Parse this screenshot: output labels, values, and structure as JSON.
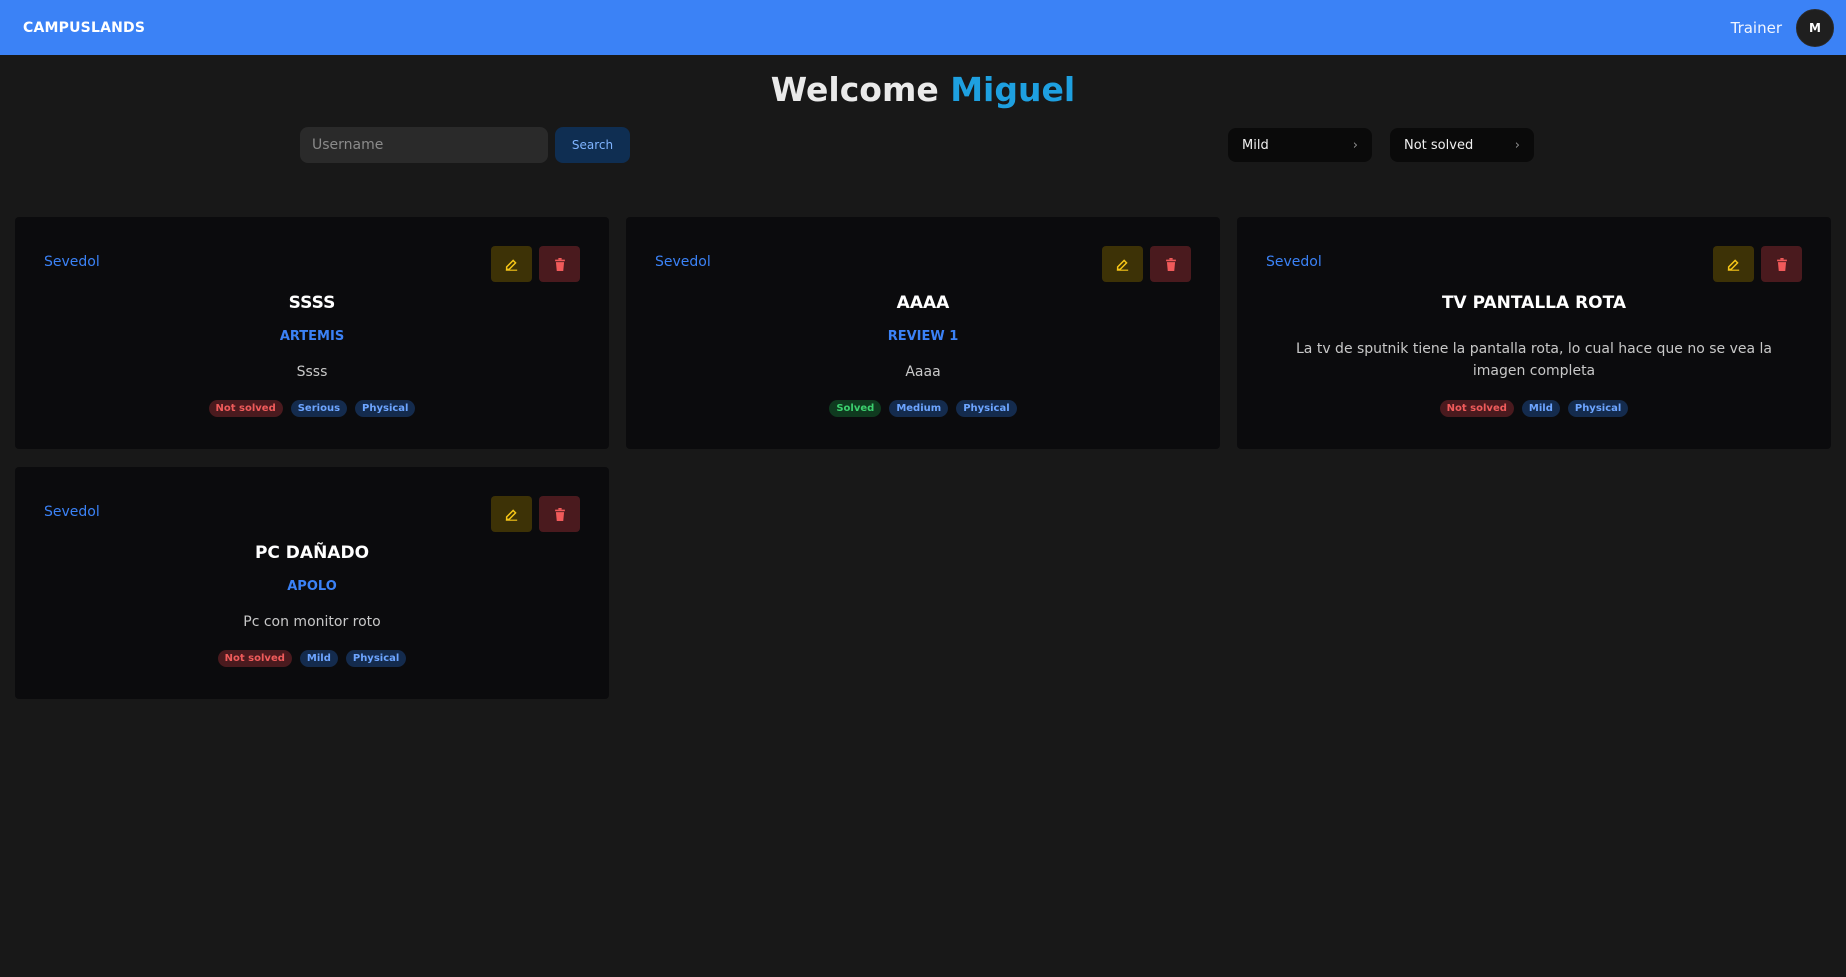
{
  "header": {
    "brand": "CAMPUSLANDS",
    "role": "Trainer",
    "avatar_initial": "M"
  },
  "welcome": {
    "prefix": "Welcome",
    "name": "Miguel"
  },
  "search": {
    "placeholder": "Username",
    "value": "",
    "button_label": "Search"
  },
  "filters": {
    "severity": "Mild",
    "status": "Not solved"
  },
  "colors": {
    "navbar": "#3b82f6",
    "accent": "#3b82f6",
    "welcome_name": "#1ea0e0"
  },
  "cards": [
    {
      "owner": "Sevedol",
      "title": "SSSS",
      "subtitle": "ARTEMIS",
      "description": "Ssss",
      "tags": {
        "status": "Not solved",
        "severity": "Serious",
        "type": "Physical"
      }
    },
    {
      "owner": "Sevedol",
      "title": "AAAA",
      "subtitle": "REVIEW 1",
      "description": "Aaaa",
      "tags": {
        "status": "Solved",
        "severity": "Medium",
        "type": "Physical"
      }
    },
    {
      "owner": "Sevedol",
      "title": "TV PANTALLA ROTA",
      "subtitle": "",
      "description": "La tv de sputnik tiene la pantalla rota, lo cual hace que no se vea la imagen completa",
      "tags": {
        "status": "Not solved",
        "severity": "Mild",
        "type": "Physical"
      }
    },
    {
      "owner": "Sevedol",
      "title": "PC DAÑADO",
      "subtitle": "APOLO",
      "description": "Pc con monitor roto",
      "tags": {
        "status": "Not solved",
        "severity": "Mild",
        "type": "Physical"
      }
    }
  ]
}
